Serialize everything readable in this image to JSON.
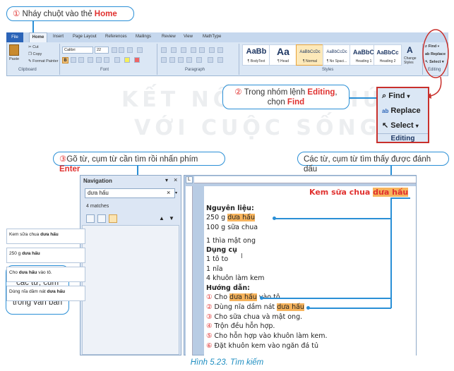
{
  "callouts": {
    "c1": {
      "num": "①",
      "text": " Nháy chuột vào thẻ ",
      "key": "Home"
    },
    "c2": {
      "num": "②",
      "text1": " Trong nhóm lệnh ",
      "key1": "Editing",
      "text2": "chọn ",
      "key2": "Find"
    },
    "c3": {
      "num": "③",
      "text": "Gõ từ, cụm từ cần tìm rồi nhấn phím ",
      "key": "Enter"
    },
    "c4": {
      "text": "Các từ, cụm từ tìm thấy được đánh dấu"
    },
    "c5": {
      "text": "Liên kết đến các từ, cụm từ tìm thấy trong văn bản"
    }
  },
  "watermark": {
    "line1": "KẾT NỐI TRI THỨC",
    "line2": "VỚI CUỘC SỐNG"
  },
  "ribbon": {
    "tabs": [
      "File",
      "Home",
      "Insert",
      "Page Layout",
      "References",
      "Mailings",
      "Review",
      "View",
      "MathType"
    ],
    "clipboard": {
      "paste": "Paste",
      "cut": "Cut",
      "copy": "Copy",
      "format_painter": "Format Painter",
      "label": "Clipboard"
    },
    "font": {
      "name": "Calibri",
      "size": "22",
      "label": "Font"
    },
    "paragraph": {
      "label": "Paragraph"
    },
    "styles": {
      "items": [
        {
          "big": "AaBb",
          "label": "¶ BodyText"
        },
        {
          "big": "Aa",
          "label": "¶ Head"
        },
        {
          "big": "AaBbCcDc",
          "label": "¶ Normal"
        },
        {
          "big": "AaBbCcDc",
          "label": "¶ No Spaci..."
        },
        {
          "big": "AaBbC",
          "label": "Heading 1"
        },
        {
          "big": "AaBbCc",
          "label": "Heading 2"
        }
      ],
      "change": "Change Styles",
      "label": "Styles"
    },
    "editing": {
      "find": "Find",
      "replace": "Replace",
      "select": "Select",
      "label": "Editing"
    }
  },
  "zoom": {
    "find": "Find",
    "replace": "Replace",
    "select": "Select",
    "label": "Editing"
  },
  "navigation": {
    "title": "Navigation",
    "search_value": "dưa hấu",
    "matches": "4 matches",
    "results": [
      {
        "pre": "Kem sữa chua ",
        "hit": "dưa hấu",
        "post": ""
      },
      {
        "pre": "250 g ",
        "hit": "dưa hấu",
        "post": ""
      },
      {
        "pre": "Cho ",
        "hit": "dưa hấu",
        "post": " vào tô."
      },
      {
        "pre": "Dùng nĩa dầm nát ",
        "hit": "dưa hấu",
        "post": ""
      }
    ]
  },
  "document": {
    "title_pre": "Kem sữa chua ",
    "title_hit": "dưa hấu",
    "lines": {
      "nguyen_lieu": "Nguyên liệu:",
      "l1_pre": "250 g ",
      "l1_hit": "dưa hấu",
      "l2": "100 g sữa chua",
      "l3": "1 thìa mật ong",
      "dung_cu": "Dụng cụ",
      "l4": "1 tô to",
      "l5": "1 nĩa",
      "l6": "4 khuôn làm kem",
      "huong_dan": "Hướng dẫn:",
      "s1_num": "①",
      "s1_pre": " Cho ",
      "s1_hit": "dưa hấu",
      "s1_post": " vào tô.",
      "s2_num": "②",
      "s2_pre": " Dùng nĩa dầm nát ",
      "s2_hit": "dưa hấu",
      "s3_num": "③",
      "s3": " Cho sữa chua và mật ong.",
      "s4_num": "④",
      "s4": " Trộn đều hỗn hợp.",
      "s5_num": "⑤",
      "s5": " Cho hỗn hợp vào khuôn làm kem.",
      "s6_num": "⑥",
      "s6": " Đặt khuôn kem vào ngăn đá tủ"
    }
  },
  "caption": "Hình 5.23. Tìm kiếm",
  "colors": {
    "accent_blue": "#2a8fd6",
    "red": "#e0312f",
    "highlight": "#f7b45d",
    "caption": "#1f8ec1"
  }
}
